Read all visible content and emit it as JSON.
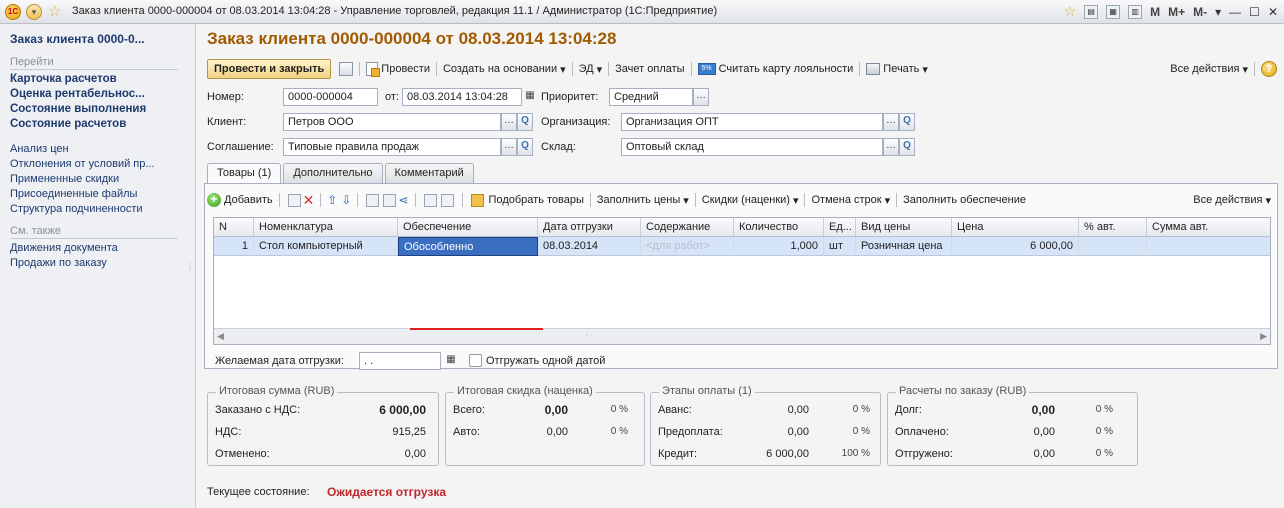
{
  "window": {
    "title": "Заказ клиента 0000-000004 от 08.03.2014 13:04:28 - Управление торговлей, редакция 11.1 / Администратор  (1С:Предприятие)",
    "logo_text": "1C",
    "mm_buttons": [
      "M",
      "M+",
      "M-"
    ]
  },
  "sidebar": {
    "title": "Заказ клиента 0000-0...",
    "goto_label": "Перейти",
    "goto_items": [
      "Карточка расчетов",
      "Оценка рентабельнос...",
      "Состояние выполнения",
      "Состояние расчетов"
    ],
    "links": [
      "Анализ цен",
      "Отклонения от условий пр...",
      "Примененные скидки",
      "Присоединенные файлы",
      "Структура подчиненности"
    ],
    "see_also_label": "См. также",
    "see_also_items": [
      "Движения документа",
      "Продажи по заказу"
    ]
  },
  "document": {
    "title": "Заказ клиента 0000-000004 от 08.03.2014 13:04:28"
  },
  "toolbar": {
    "post_close": "Провести и закрыть",
    "post": "Провести",
    "create_based": "Создать на основании",
    "ed": "ЭД",
    "offset_payment": "Зачет оплаты",
    "loyalty_card": "Считать карту лояльности",
    "print": "Печать",
    "all_actions": "Все действия",
    "card_icon_text": "5%"
  },
  "form": {
    "number_label": "Номер:",
    "number_value": "0000-000004",
    "from_label": "от:",
    "date_value": "08.03.2014 13:04:28",
    "priority_label": "Приоритет:",
    "priority_value": "Средний",
    "client_label": "Клиент:",
    "client_value": "Петров ООО",
    "org_label": "Организация:",
    "org_value": "Организация ОПТ",
    "agreement_label": "Соглашение:",
    "agreement_value": "Типовые правила продаж",
    "warehouse_label": "Склад:",
    "warehouse_value": "Оптовый склад"
  },
  "tabs": [
    "Товары (1)",
    "Дополнительно",
    "Комментарий"
  ],
  "goods_toolbar": {
    "add": "Добавить",
    "pick_goods": "Подобрать товары",
    "fill_prices": "Заполнить цены",
    "discounts": "Скидки (наценки)",
    "cancel_rows": "Отмена строк",
    "fill_supply": "Заполнить обеспечение",
    "all_actions": "Все действия"
  },
  "table": {
    "columns": [
      "N",
      "Номенклатура",
      "Обеспечение",
      "Дата отгрузки",
      "Содержание",
      "Количество",
      "Ед...",
      "Вид цены",
      "Цена",
      "% авт.",
      "Сумма авт."
    ],
    "rows": [
      [
        "1",
        "Стол компьютерный",
        "Обособленно",
        "08.03.2014",
        "<для работ>",
        "1,000",
        "шт",
        "Розничная цена",
        "6 000,00",
        "",
        ""
      ]
    ]
  },
  "shipment": {
    "desired_date_label": "Желаемая дата отгрузки:",
    "desired_date_value": " .  .",
    "one_date_label": "Отгружать одной датой",
    "one_date_checked": false
  },
  "totals": {
    "total_sum": {
      "title": "Итоговая сумма (RUB)",
      "rows": [
        [
          "Заказано с НДС:",
          "6 000,00"
        ],
        [
          "НДС:",
          "915,25"
        ],
        [
          "Отменено:",
          "0,00"
        ]
      ]
    },
    "total_discount": {
      "title": "Итоговая скидка (наценка)",
      "rows": [
        [
          "Всего:",
          "0,00",
          "0 %"
        ],
        [
          "Авто:",
          "0,00",
          "0 %"
        ]
      ]
    },
    "payment_stages": {
      "title": "Этапы оплаты (1)",
      "rows": [
        [
          "Аванс:",
          "0,00",
          "0 %"
        ],
        [
          "Предоплата:",
          "0,00",
          "0 %"
        ],
        [
          "Кредит:",
          "6 000,00",
          "100 %"
        ]
      ]
    },
    "settlements": {
      "title": "Расчеты по заказу (RUB)",
      "rows": [
        [
          "Долг:",
          "0,00",
          "0 %"
        ],
        [
          "Оплачено:",
          "0,00",
          "0 %"
        ],
        [
          "Отгружено:",
          "0,00",
          "0 %"
        ]
      ]
    }
  },
  "status": {
    "label": "Текущее состояние:",
    "value": "Ожидается отгрузка"
  },
  "colors": {
    "title_accent": "#a05a00",
    "selection": "#3a6ec0",
    "status_red": "#c0262c",
    "annotation_underline": "#e02020"
  }
}
